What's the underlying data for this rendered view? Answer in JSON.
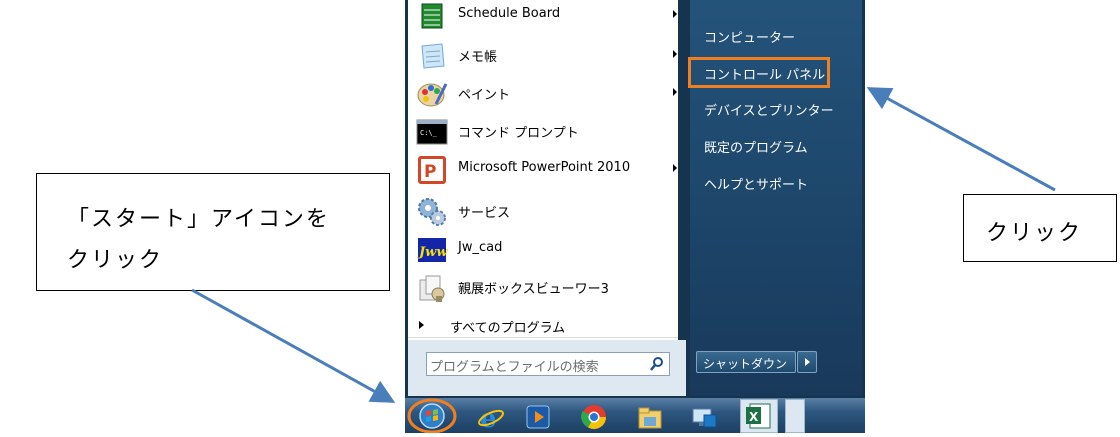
{
  "start_menu": {
    "programs": [
      {
        "label": "Schedule Board",
        "icon": "schedule-board-icon",
        "has_submenu": true
      },
      {
        "label": "メモ帳",
        "icon": "notepad-icon",
        "has_submenu": true
      },
      {
        "label": "ペイント",
        "icon": "paint-icon",
        "has_submenu": true
      },
      {
        "label": "コマンド プロンプト",
        "icon": "command-prompt-icon",
        "has_submenu": false
      },
      {
        "label": "Microsoft PowerPoint 2010",
        "icon": "powerpoint-icon",
        "has_submenu": true
      },
      {
        "label": "サービス",
        "icon": "services-gear-icon",
        "has_submenu": false
      },
      {
        "label": "Jw_cad",
        "icon": "jwcad-icon",
        "has_submenu": false
      },
      {
        "label": "親展ボックスビューワー3",
        "icon": "confidential-box-viewer-icon",
        "has_submenu": false
      }
    ],
    "all_programs_label": "すべてのプログラム",
    "search_placeholder": "プログラムとファイルの検索",
    "right_items": [
      "コンピューター",
      "コントロール パネル",
      "デバイスとプリンター",
      "既定のプログラム",
      "ヘルプとサポート"
    ],
    "shutdown_label": "シャットダウン"
  },
  "taskbar": {
    "icons": [
      "start-orb-icon",
      "internet-explorer-icon",
      "media-player-icon",
      "chrome-icon",
      "explorer-folder-icon",
      "network-icon",
      "excel-icon"
    ]
  },
  "callouts": {
    "start_line1": "「スタート」アイコンを",
    "start_line2": "クリック",
    "click": "クリック"
  },
  "colors": {
    "highlight": "#f07f22",
    "arrow": "#4a7ebb"
  }
}
